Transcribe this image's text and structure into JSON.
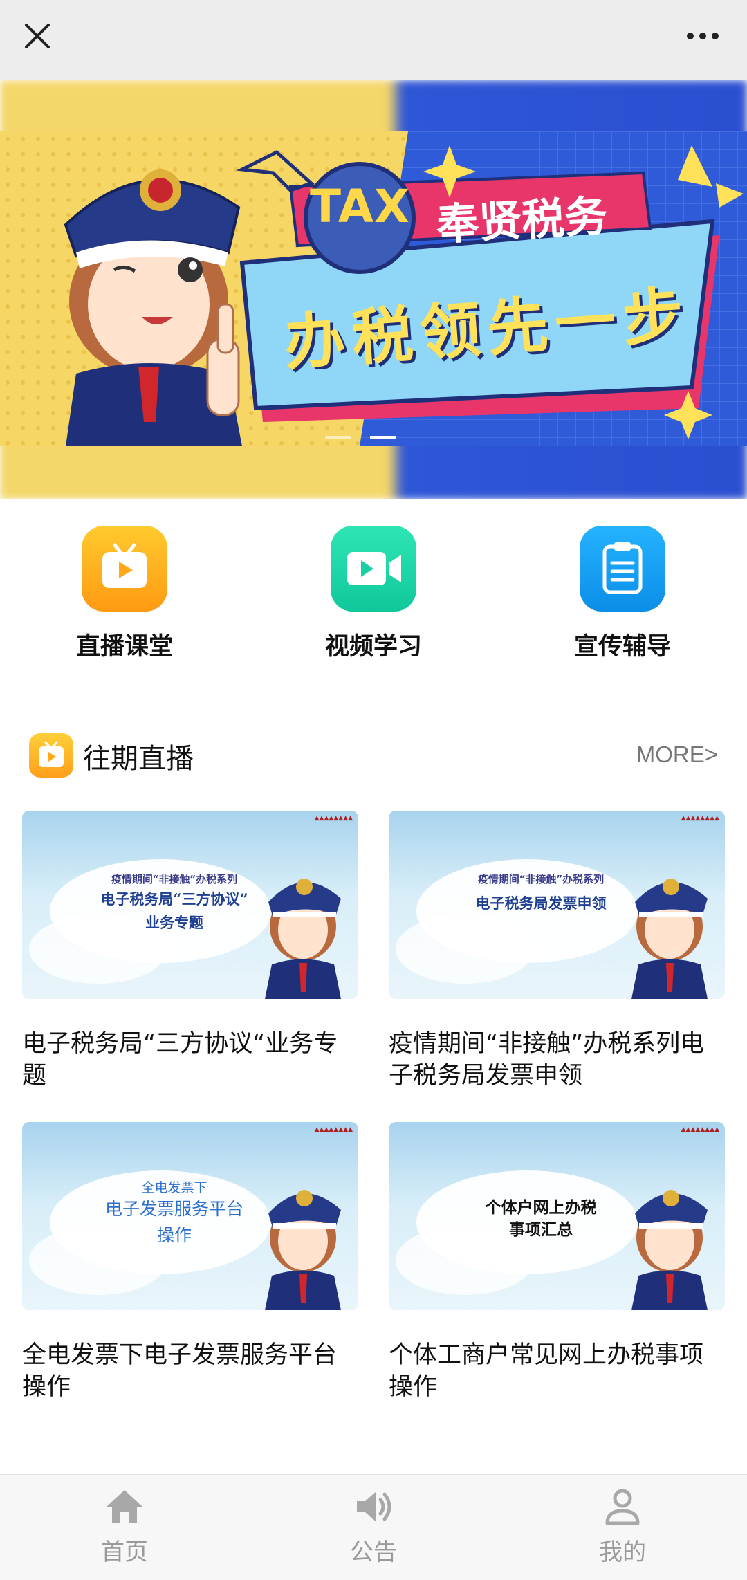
{
  "topbar": {
    "close_icon": "close-icon",
    "more_icon": "more-dots-icon"
  },
  "banner": {
    "tax_badge": "TAX",
    "title": "奉贤税务",
    "slogan": "办税领先一步",
    "slides": 2,
    "active_slide": 2
  },
  "quick_actions": [
    {
      "label": "直播课堂",
      "icon": "tv-play-icon",
      "color": "#ffb21f"
    },
    {
      "label": "视频学习",
      "icon": "video-camera-icon",
      "color": "#1ed8a8"
    },
    {
      "label": "宣传辅导",
      "icon": "clipboard-icon",
      "color": "#1a9cf0"
    }
  ],
  "section": {
    "title": "往期直播",
    "more": "MORE>"
  },
  "cards": [
    {
      "thumb_lines": [
        "疫情期间“非接触”办税系列",
        "电子税务局“三方协议”",
        "业务专题"
      ],
      "title": "电子税务局“三方协议“业务专题"
    },
    {
      "thumb_lines": [
        "疫情期间“非接触”办税系列",
        "电子税务局发票申领"
      ],
      "title": "疫情期间“非接触”办税系列电子税务局发票申领"
    },
    {
      "thumb_lines": [
        "全电发票下",
        "电子发票服务平台",
        "操作"
      ],
      "title": "全电发票下电子发票服务平台操作"
    },
    {
      "thumb_lines": [
        "个体户网上办税",
        "事项汇总"
      ],
      "title": "个体工商户常见网上办税事项操作"
    }
  ],
  "bottom_nav": [
    {
      "label": "首页",
      "icon": "home-icon"
    },
    {
      "label": "公告",
      "icon": "speaker-icon"
    },
    {
      "label": "我的",
      "icon": "user-icon"
    }
  ]
}
